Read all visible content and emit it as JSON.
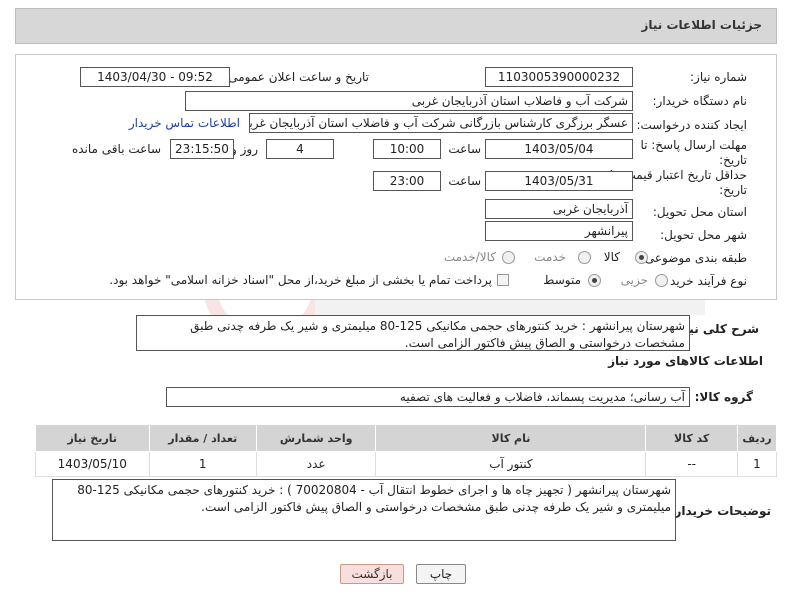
{
  "header": {
    "title": "جزئیات اطلاعات نیاز"
  },
  "form": {
    "need_number_label": "شماره نیاز:",
    "need_number": "1103005390000232",
    "announce_label": "تاریخ و ساعت اعلان عمومی:",
    "announce_value": "1403/04/30 - 09:52",
    "buyer_org_label": "نام دستگاه خریدار:",
    "buyer_org": "شرکت آب و فاضلاب استان آذربایجان غربی",
    "creator_label": "ایجاد کننده درخواست:",
    "creator": "عسگر  برزگری کارشناس بازرگانی شرکت آب و فاضلاب استان آذربایجان غربی",
    "contact_link": "اطلاعات تماس خریدار",
    "deadline_label_1": "مهلت ارسال پاسخ: تا",
    "deadline_label_2": "تاریخ:",
    "deadline_date": "1403/05/04",
    "time_label": "ساعت",
    "deadline_time": "10:00",
    "days_value": "4",
    "days_label": "روز و",
    "remaining_time": "23:15:50",
    "remaining_label": "ساعت باقی مانده",
    "validity_label_1": "حداقل تاریخ اعتبار قیمت: تا",
    "validity_label_2": "تاریخ:",
    "validity_date": "1403/05/31",
    "validity_time": "23:00",
    "province_label": "استان محل تحویل:",
    "province": "آذربایجان غربی",
    "city_label": "شهر محل تحویل:",
    "city": "پیرانشهر",
    "category_label": "طبقه بندی موضوعی:",
    "category_options": [
      "کالا",
      "خدمت",
      "کالا/خدمت"
    ],
    "process_label": "نوع فرآیند خرید :",
    "process_options": [
      "جزیی",
      "متوسط"
    ],
    "payment_note": "پرداخت تمام یا بخشی از مبلغ خرید،از محل \"اسناد خزانه اسلامی\" خواهد بود."
  },
  "summary": {
    "label": "شرح کلی نیاز:",
    "text": "شهرستان پیرانشهر : خرید  کنتورهای حجمی مکانیکی  125-80 میلیمتری و شیر یک طرفه چدنی طبق مشخصات درخواستی و الصاق پیش فاکتور الزامی است."
  },
  "goods_section": {
    "title": "اطلاعات کالاهای مورد نیاز",
    "group_label": "گروه کالا:",
    "group_value": "آب رسانی؛ مدیریت پسماند، فاضلاب و فعالیت های تصفیه"
  },
  "table": {
    "headers": [
      "ردیف",
      "کد کالا",
      "نام کالا",
      "واحد شمارش",
      "تعداد / مقدار",
      "تاریخ نیاز"
    ],
    "rows": [
      {
        "index": "1",
        "code": "--",
        "name": "کنتور آب",
        "unit": "عدد",
        "qty": "1",
        "date": "1403/05/10"
      }
    ]
  },
  "buyer_notes": {
    "label": "توضیحات خریدار:",
    "text": "شهرستان پیرانشهر ( تجهیز چاه ها و اجرای خطوط انتقال آب - 70020804 ) : خرید  کنتورهای حجمی مکانیکی  125-80 میلیمتری و شیر یک طرفه چدنی طبق مشخصات درخواستی و الصاق پیش فاکتور الزامی است."
  },
  "buttons": {
    "print": "چاپ",
    "back": "بازگشت"
  },
  "colors": {
    "header_bg": "#d7d7d7",
    "link": "#1a3fa8",
    "back_btn_bg": "#f9dede",
    "table_header_bg": "#d4d4d4"
  }
}
